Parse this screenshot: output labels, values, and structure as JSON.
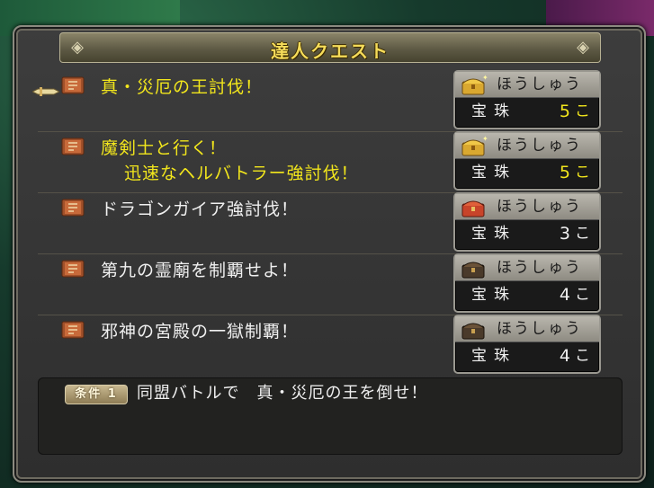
{
  "window": {
    "title": "達人クエスト"
  },
  "quests": [
    {
      "name_line1": "真・災厄の王討伐！",
      "name_line2": "",
      "highlight": true,
      "selected": true,
      "reward": {
        "label": "ほうしゅう",
        "item": "宝珠",
        "count": "5",
        "unit": "こ",
        "chest": "gold-chest-icon"
      }
    },
    {
      "name_line1": "魔剣士と行く！",
      "name_line2": "迅速なヘルバトラー強討伐！",
      "highlight": true,
      "selected": false,
      "reward": {
        "label": "ほうしゅう",
        "item": "宝珠",
        "count": "5",
        "unit": "こ",
        "chest": "gold-chest-icon"
      }
    },
    {
      "name_line1": "ドラゴンガイア強討伐！",
      "name_line2": "",
      "highlight": false,
      "selected": false,
      "reward": {
        "label": "ほうしゅう",
        "item": "宝珠",
        "count": "3",
        "unit": "こ",
        "chest": "red-chest-icon"
      }
    },
    {
      "name_line1": "第九の霊廟を制覇せよ！",
      "name_line2": "",
      "highlight": false,
      "selected": false,
      "reward": {
        "label": "ほうしゅう",
        "item": "宝珠",
        "count": "4",
        "unit": "こ",
        "chest": "dark-chest-icon"
      }
    },
    {
      "name_line1": "邪神の宮殿の一獄制覇！",
      "name_line2": "",
      "highlight": false,
      "selected": false,
      "reward": {
        "label": "ほうしゅう",
        "item": "宝珠",
        "count": "4",
        "unit": "こ",
        "chest": "dark-chest-icon"
      }
    }
  ],
  "condition": {
    "badge": "条件 1",
    "text": "同盟バトルで　真・災厄の王を倒せ！"
  },
  "colors": {
    "highlight_text": "#f2e61c",
    "normal_text": "#f0f0f0",
    "title_text": "#f5dc5a"
  }
}
